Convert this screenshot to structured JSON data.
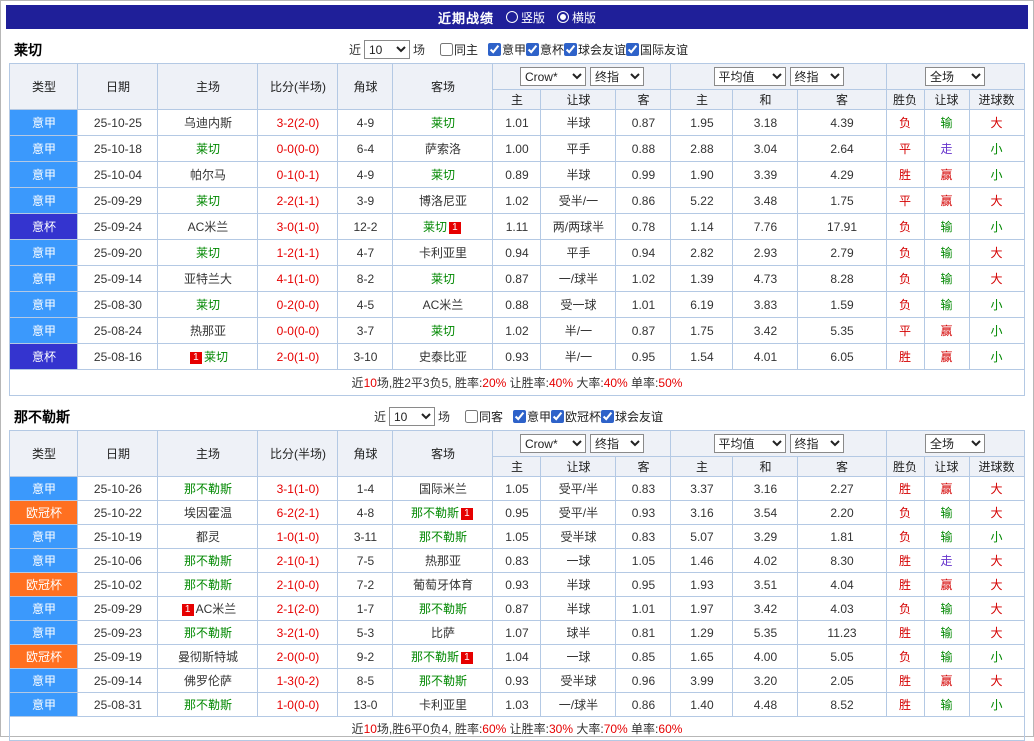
{
  "topbar": {
    "title": "近期战绩",
    "radios": [
      {
        "label": "竖版",
        "selected": false
      },
      {
        "label": "横版",
        "selected": true
      }
    ]
  },
  "colors": {
    "topbar_bg": "#1f1f99",
    "grid_border": "#b4c9e4",
    "score_red": "#e60000",
    "focus_team_green": "#008800"
  },
  "league_colors": {
    "意甲": "#3b99fc",
    "意杯": "#3434cf",
    "欧冠杯": "#ff7020"
  },
  "result_colors": {
    "胜": "#d40000",
    "平": "#d40000",
    "负": "#d40000",
    "赢": "#d40000",
    "输": "#008800",
    "走": "#6633cc",
    "大": "#d40000",
    "小": "#008800"
  },
  "table_headers": {
    "static": [
      "类型",
      "日期",
      "主场",
      "比分(半场)",
      "角球",
      "客场"
    ],
    "sub": [
      "主",
      "让球",
      "客",
      "主",
      "和",
      "客",
      "胜负",
      "让球",
      "进球数"
    ],
    "selects": {
      "odds_source": "Crow*",
      "odds_type": "终指",
      "avg": "平均值",
      "avg_type": "终指",
      "scope": "全场"
    }
  },
  "tables": [
    {
      "team": "莱切",
      "filter": {
        "prefix": "近",
        "count": "10",
        "suffix": "场",
        "same": {
          "label": "同主",
          "checked": false
        },
        "comps": [
          {
            "label": "意甲",
            "checked": true
          },
          {
            "label": "意杯",
            "checked": true
          },
          {
            "label": "球会友谊",
            "checked": true
          },
          {
            "label": "国际友谊",
            "checked": true
          }
        ]
      },
      "rows": [
        {
          "league": "意甲",
          "date": "25-10-25",
          "home": {
            "n": "乌迪内斯"
          },
          "score": "3-2(2-0)",
          "corner": "4-9",
          "away": {
            "n": "莱切",
            "g": 1
          },
          "odds": [
            "1.01",
            "半球",
            "0.87"
          ],
          "avg": [
            "1.95",
            "3.18",
            "4.39"
          ],
          "res": [
            "负",
            "输",
            "大"
          ]
        },
        {
          "league": "意甲",
          "date": "25-10-18",
          "home": {
            "n": "莱切",
            "g": 1
          },
          "score": "0-0(0-0)",
          "corner": "6-4",
          "away": {
            "n": "萨索洛"
          },
          "odds": [
            "1.00",
            "平手",
            "0.88"
          ],
          "avg": [
            "2.88",
            "3.04",
            "2.64"
          ],
          "res": [
            "平",
            "走",
            "小"
          ]
        },
        {
          "league": "意甲",
          "date": "25-10-04",
          "home": {
            "n": "帕尔马"
          },
          "score": "0-1(0-1)",
          "corner": "4-9",
          "away": {
            "n": "莱切",
            "g": 1
          },
          "odds": [
            "0.89",
            "半球",
            "0.99"
          ],
          "avg": [
            "1.90",
            "3.39",
            "4.29"
          ],
          "res": [
            "胜",
            "赢",
            "小"
          ]
        },
        {
          "league": "意甲",
          "date": "25-09-29",
          "home": {
            "n": "莱切",
            "g": 1
          },
          "score": "2-2(1-1)",
          "corner": "3-9",
          "away": {
            "n": "博洛尼亚"
          },
          "odds": [
            "1.02",
            "受半/一",
            "0.86"
          ],
          "avg": [
            "5.22",
            "3.48",
            "1.75"
          ],
          "res": [
            "平",
            "赢",
            "大"
          ]
        },
        {
          "league": "意杯",
          "date": "25-09-24",
          "home": {
            "n": "AC米兰"
          },
          "score": "3-0(1-0)",
          "corner": "12-2",
          "away": {
            "n": "莱切",
            "g": 1,
            "post": "1"
          },
          "odds": [
            "1.11",
            "两/两球半",
            "0.78"
          ],
          "avg": [
            "1.14",
            "7.76",
            "17.91"
          ],
          "res": [
            "负",
            "输",
            "小"
          ]
        },
        {
          "league": "意甲",
          "date": "25-09-20",
          "home": {
            "n": "莱切",
            "g": 1
          },
          "score": "1-2(1-1)",
          "corner": "4-7",
          "away": {
            "n": "卡利亚里"
          },
          "odds": [
            "0.94",
            "平手",
            "0.94"
          ],
          "avg": [
            "2.82",
            "2.93",
            "2.79"
          ],
          "res": [
            "负",
            "输",
            "大"
          ]
        },
        {
          "league": "意甲",
          "date": "25-09-14",
          "home": {
            "n": "亚特兰大"
          },
          "score": "4-1(1-0)",
          "corner": "8-2",
          "away": {
            "n": "莱切",
            "g": 1
          },
          "odds": [
            "0.87",
            "一/球半",
            "1.02"
          ],
          "avg": [
            "1.39",
            "4.73",
            "8.28"
          ],
          "res": [
            "负",
            "输",
            "大"
          ]
        },
        {
          "league": "意甲",
          "date": "25-08-30",
          "home": {
            "n": "莱切",
            "g": 1
          },
          "score": "0-2(0-0)",
          "corner": "4-5",
          "away": {
            "n": "AC米兰"
          },
          "odds": [
            "0.88",
            "受一球",
            "1.01"
          ],
          "avg": [
            "6.19",
            "3.83",
            "1.59"
          ],
          "res": [
            "负",
            "输",
            "小"
          ]
        },
        {
          "league": "意甲",
          "date": "25-08-24",
          "home": {
            "n": "热那亚"
          },
          "score": "0-0(0-0)",
          "corner": "3-7",
          "away": {
            "n": "莱切",
            "g": 1
          },
          "odds": [
            "1.02",
            "半/一",
            "0.87"
          ],
          "avg": [
            "1.75",
            "3.42",
            "5.35"
          ],
          "res": [
            "平",
            "赢",
            "小"
          ]
        },
        {
          "league": "意杯",
          "date": "25-08-16",
          "home": {
            "n": "莱切",
            "g": 1,
            "pre": "1"
          },
          "score": "2-0(1-0)",
          "corner": "3-10",
          "away": {
            "n": "史泰比亚"
          },
          "odds": [
            "0.93",
            "半/一",
            "0.95"
          ],
          "avg": [
            "1.54",
            "4.01",
            "6.05"
          ],
          "res": [
            "胜",
            "赢",
            "小"
          ]
        }
      ],
      "summary": [
        {
          "t": "近"
        },
        {
          "t": "10",
          "r": 1
        },
        {
          "t": "场,胜2平3负5, 胜率:"
        },
        {
          "t": "20%",
          "r": 1
        },
        {
          "t": " 让胜率:"
        },
        {
          "t": "40%",
          "r": 1
        },
        {
          "t": " 大率:"
        },
        {
          "t": "40%",
          "r": 1
        },
        {
          "t": " 单率:"
        },
        {
          "t": "50%",
          "r": 1
        }
      ]
    },
    {
      "team": "那不勒斯",
      "filter": {
        "prefix": "近",
        "count": "10",
        "suffix": "场",
        "same": {
          "label": "同客",
          "checked": false
        },
        "comps": [
          {
            "label": "意甲",
            "checked": true
          },
          {
            "label": "欧冠杯",
            "checked": true
          },
          {
            "label": "球会友谊",
            "checked": true
          }
        ]
      },
      "rows": [
        {
          "league": "意甲",
          "date": "25-10-26",
          "home": {
            "n": "那不勒斯",
            "g": 1
          },
          "score": "3-1(1-0)",
          "corner": "1-4",
          "away": {
            "n": "国际米兰"
          },
          "odds": [
            "1.05",
            "受平/半",
            "0.83"
          ],
          "avg": [
            "3.37",
            "3.16",
            "2.27"
          ],
          "res": [
            "胜",
            "赢",
            "大"
          ]
        },
        {
          "league": "欧冠杯",
          "date": "25-10-22",
          "home": {
            "n": "埃因霍温"
          },
          "score": "6-2(2-1)",
          "corner": "4-8",
          "away": {
            "n": "那不勒斯",
            "g": 1,
            "post": "1"
          },
          "odds": [
            "0.95",
            "受平/半",
            "0.93"
          ],
          "avg": [
            "3.16",
            "3.54",
            "2.20"
          ],
          "res": [
            "负",
            "输",
            "大"
          ]
        },
        {
          "league": "意甲",
          "date": "25-10-19",
          "home": {
            "n": "都灵"
          },
          "score": "1-0(1-0)",
          "corner": "3-11",
          "away": {
            "n": "那不勒斯",
            "g": 1
          },
          "odds": [
            "1.05",
            "受半球",
            "0.83"
          ],
          "avg": [
            "5.07",
            "3.29",
            "1.81"
          ],
          "res": [
            "负",
            "输",
            "小"
          ]
        },
        {
          "league": "意甲",
          "date": "25-10-06",
          "home": {
            "n": "那不勒斯",
            "g": 1
          },
          "score": "2-1(0-1)",
          "corner": "7-5",
          "away": {
            "n": "热那亚"
          },
          "odds": [
            "0.83",
            "一球",
            "1.05"
          ],
          "avg": [
            "1.46",
            "4.02",
            "8.30"
          ],
          "res": [
            "胜",
            "走",
            "大"
          ]
        },
        {
          "league": "欧冠杯",
          "date": "25-10-02",
          "home": {
            "n": "那不勒斯",
            "g": 1
          },
          "score": "2-1(0-0)",
          "corner": "7-2",
          "away": {
            "n": "葡萄牙体育"
          },
          "odds": [
            "0.93",
            "半球",
            "0.95"
          ],
          "avg": [
            "1.93",
            "3.51",
            "4.04"
          ],
          "res": [
            "胜",
            "赢",
            "大"
          ]
        },
        {
          "league": "意甲",
          "date": "25-09-29",
          "home": {
            "n": "AC米兰",
            "pre": "1"
          },
          "score": "2-1(2-0)",
          "corner": "1-7",
          "away": {
            "n": "那不勒斯",
            "g": 1
          },
          "odds": [
            "0.87",
            "半球",
            "1.01"
          ],
          "avg": [
            "1.97",
            "3.42",
            "4.03"
          ],
          "res": [
            "负",
            "输",
            "大"
          ]
        },
        {
          "league": "意甲",
          "date": "25-09-23",
          "home": {
            "n": "那不勒斯",
            "g": 1
          },
          "score": "3-2(1-0)",
          "corner": "5-3",
          "away": {
            "n": "比萨"
          },
          "odds": [
            "1.07",
            "球半",
            "0.81"
          ],
          "avg": [
            "1.29",
            "5.35",
            "11.23"
          ],
          "res": [
            "胜",
            "输",
            "大"
          ]
        },
        {
          "league": "欧冠杯",
          "date": "25-09-19",
          "home": {
            "n": "曼彻斯特城"
          },
          "score": "2-0(0-0)",
          "corner": "9-2",
          "away": {
            "n": "那不勒斯",
            "g": 1,
            "post": "1"
          },
          "odds": [
            "1.04",
            "一球",
            "0.85"
          ],
          "avg": [
            "1.65",
            "4.00",
            "5.05"
          ],
          "res": [
            "负",
            "输",
            "小"
          ]
        },
        {
          "league": "意甲",
          "date": "25-09-14",
          "home": {
            "n": "佛罗伦萨"
          },
          "score": "1-3(0-2)",
          "corner": "8-5",
          "away": {
            "n": "那不勒斯",
            "g": 1
          },
          "odds": [
            "0.93",
            "受半球",
            "0.96"
          ],
          "avg": [
            "3.99",
            "3.20",
            "2.05"
          ],
          "res": [
            "胜",
            "赢",
            "大"
          ]
        },
        {
          "league": "意甲",
          "date": "25-08-31",
          "home": {
            "n": "那不勒斯",
            "g": 1
          },
          "score": "1-0(0-0)",
          "corner": "13-0",
          "away": {
            "n": "卡利亚里"
          },
          "odds": [
            "1.03",
            "一/球半",
            "0.86"
          ],
          "avg": [
            "1.40",
            "4.48",
            "8.52"
          ],
          "res": [
            "胜",
            "输",
            "小"
          ]
        }
      ],
      "summary": [
        {
          "t": "近"
        },
        {
          "t": "10",
          "r": 1
        },
        {
          "t": "场,胜6平0负4, 胜率:"
        },
        {
          "t": "60%",
          "r": 1
        },
        {
          "t": " 让胜率:"
        },
        {
          "t": "30%",
          "r": 1
        },
        {
          "t": " 大率:"
        },
        {
          "t": "70%",
          "r": 1
        },
        {
          "t": " 单率:"
        },
        {
          "t": "60%",
          "r": 1
        }
      ]
    }
  ]
}
